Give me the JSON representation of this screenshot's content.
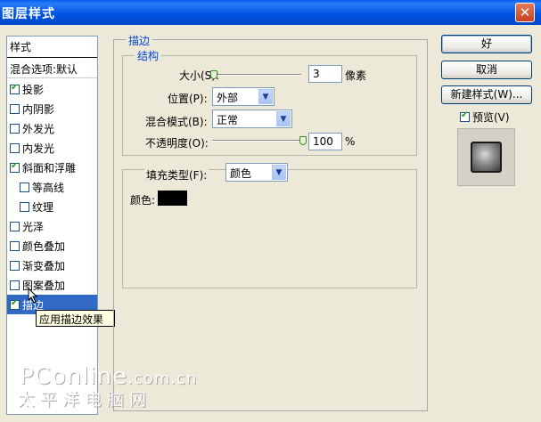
{
  "window": {
    "title": "图层样式",
    "close_glyph": "✕"
  },
  "style_list": {
    "header": "样式",
    "blend_options": "混合选项:默认",
    "items": [
      {
        "label": "投影",
        "checked": true
      },
      {
        "label": "内阴影",
        "checked": false
      },
      {
        "label": "外发光",
        "checked": false
      },
      {
        "label": "内发光",
        "checked": false
      },
      {
        "label": "斜面和浮雕",
        "checked": true
      },
      {
        "label": "等高线",
        "checked": false
      },
      {
        "label": "纹理",
        "checked": false
      },
      {
        "label": "光泽",
        "checked": false
      },
      {
        "label": "颜色叠加",
        "checked": false
      },
      {
        "label": "渐变叠加",
        "checked": false
      },
      {
        "label": "图案叠加",
        "checked": false
      },
      {
        "label": "描边",
        "checked": true,
        "selected": true
      }
    ],
    "tooltip": "应用描边效果"
  },
  "stroke": {
    "section_title": "描边",
    "structure": {
      "title": "结构",
      "size_label": "大小(S):",
      "size_value": "3",
      "size_unit": "像素",
      "position_label": "位置(P):",
      "position_value": "外部",
      "blend_mode_label": "混合模式(B):",
      "blend_mode_value": "正常",
      "opacity_label": "不透明度(O):",
      "opacity_value": "100",
      "opacity_unit": "%"
    },
    "fill": {
      "fill_type_label": "填充类型(F):",
      "fill_type_value": "颜色",
      "color_label": "颜色:",
      "color_hex": "#000000"
    }
  },
  "buttons": {
    "ok": "好",
    "cancel": "取消",
    "new_style": "新建样式(W)...",
    "preview_label": "预览(V)",
    "preview_checked": true
  },
  "watermark": {
    "line1_main": "PConline",
    "line1_tail": ".com.cn",
    "line2": "太平洋电脑网"
  },
  "colors": {
    "titlebar": "#0054e3",
    "selection": "#316ac5",
    "accent_text": "#0046d5",
    "dialog_bg": "#ece9d8"
  }
}
